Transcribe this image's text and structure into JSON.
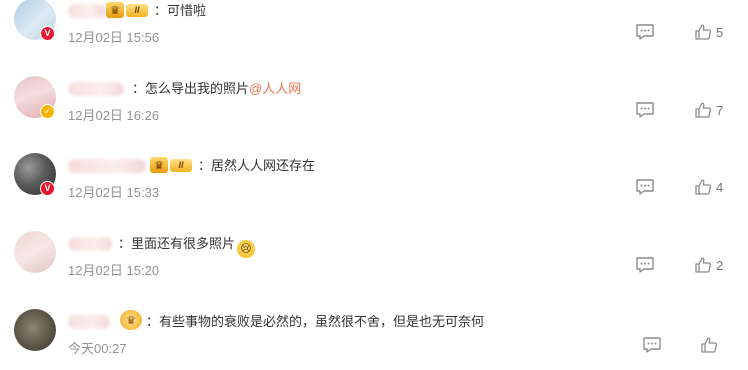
{
  "comments": [
    {
      "text": "：可惜啦",
      "time": "12月02日 15:56",
      "likes": "5",
      "badge": "v-red",
      "crown_level": "II"
    },
    {
      "text": "：怎么导出我的照片",
      "mention": "@人人网",
      "time": "12月02日 16:26",
      "likes": "7",
      "badge": "v-gold"
    },
    {
      "text": "：居然人人网还存在",
      "time": "12月02日 15:33",
      "likes": "4",
      "badge": "v-red",
      "crown_level": "II"
    },
    {
      "text": "：里面还有很多照片",
      "emoji": "crying-face-emoji",
      "time": "12月02日 15:20",
      "likes": "2"
    },
    {
      "text": "：有些事物的衰败是必然的，虽然很不舍，但是也无可奈何",
      "time": "今天00:27",
      "likes": ""
    }
  ],
  "icons": {
    "reply": "comment-icon",
    "like": "thumbs-up-icon",
    "crown": "crown-icon"
  },
  "colors": {
    "mention": "#eb7350",
    "time": "#939393",
    "text": "#333333",
    "badge_red": "#e6162d",
    "badge_gold": "#f7b500"
  }
}
